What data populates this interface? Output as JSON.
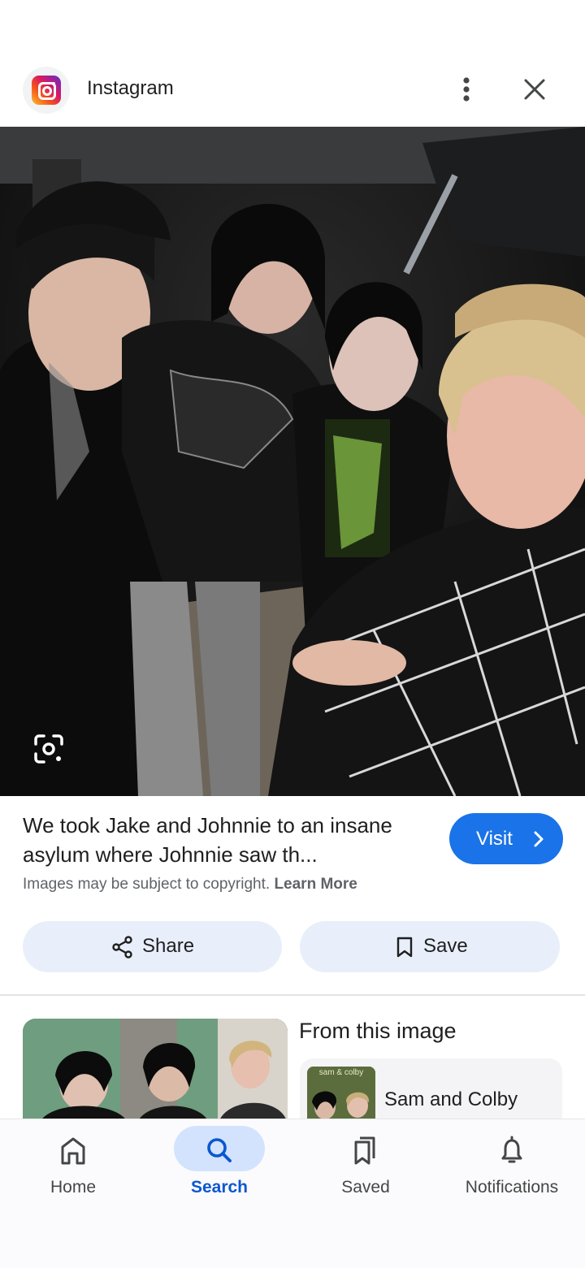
{
  "header": {
    "app_name": "Instagram",
    "app_icon": "instagram-logo-icon",
    "more_icon": "more-vert-icon",
    "close_icon": "close-icon"
  },
  "image": {
    "lens_icon": "google-lens-icon"
  },
  "result": {
    "title": "We took Jake and Johnnie to an insane asylum where Johnnie saw th...",
    "visit_label": "Visit",
    "copyright_text": "Images may be subject to copyright.",
    "learn_more": "Learn More"
  },
  "actions": {
    "share_label": "Share",
    "save_label": "Save"
  },
  "related": {
    "from_title": "From this image",
    "entity_name": "Sam and Colby",
    "entity_thumb_caption": "sam & colby"
  },
  "nav": {
    "items": [
      {
        "label": "Home",
        "icon": "home-icon"
      },
      {
        "label": "Search",
        "icon": "search-icon",
        "active": true
      },
      {
        "label": "Saved",
        "icon": "bookmarks-icon"
      },
      {
        "label": "Notifications",
        "icon": "bell-icon"
      }
    ]
  },
  "colors": {
    "accent": "#1a73e8",
    "pill_bg": "#e8effa",
    "nav_active_bg": "#d3e3fd",
    "nav_active_text": "#0b57d0"
  }
}
